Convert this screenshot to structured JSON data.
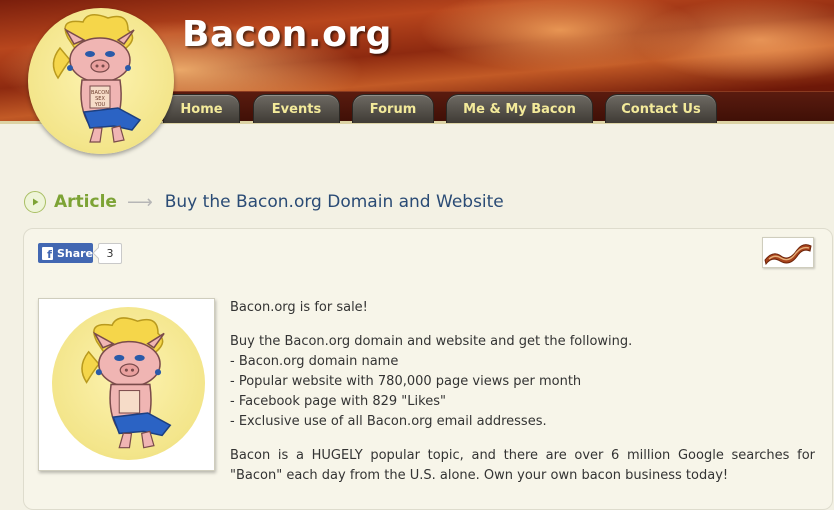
{
  "site": {
    "title": "Bacon.org"
  },
  "nav": {
    "items": [
      {
        "label": "Home"
      },
      {
        "label": "Events"
      },
      {
        "label": "Forum"
      },
      {
        "label": "Me & My Bacon"
      },
      {
        "label": "Contact Us"
      }
    ]
  },
  "breadcrumb": {
    "section": "Article",
    "arrow": "⟶",
    "title": "Buy the Bacon.org Domain and Website"
  },
  "share": {
    "label": "Share",
    "fb_glyph": "f",
    "count": "3"
  },
  "article": {
    "intro": "Bacon.org is for sale!",
    "lead": "Buy the Bacon.org domain and website and get the following.",
    "features": [
      "- Bacon.org domain name",
      "- Popular website with 780,000 page views per month",
      "- Facebook page with 829 \"Likes\"",
      "- Exclusive use of all Bacon.org email addresses."
    ],
    "pitch": "Bacon is a HUGELY popular topic, and there are over 6 million Google searches for \"Bacon\" each day from the U.S. alone. Own your own bacon business today!"
  },
  "logo_text": "BACON SEX YOU",
  "icons": {
    "breadcrumb": "play-circle-icon",
    "share": "facebook-icon",
    "thumbnail": "bacon-strip-icon"
  },
  "colors": {
    "nav_text": "#f3ea9a",
    "article_link": "#7da335",
    "title_blue": "#2a4b75",
    "facebook": "#4267b2",
    "background": "#f3f1e4"
  }
}
